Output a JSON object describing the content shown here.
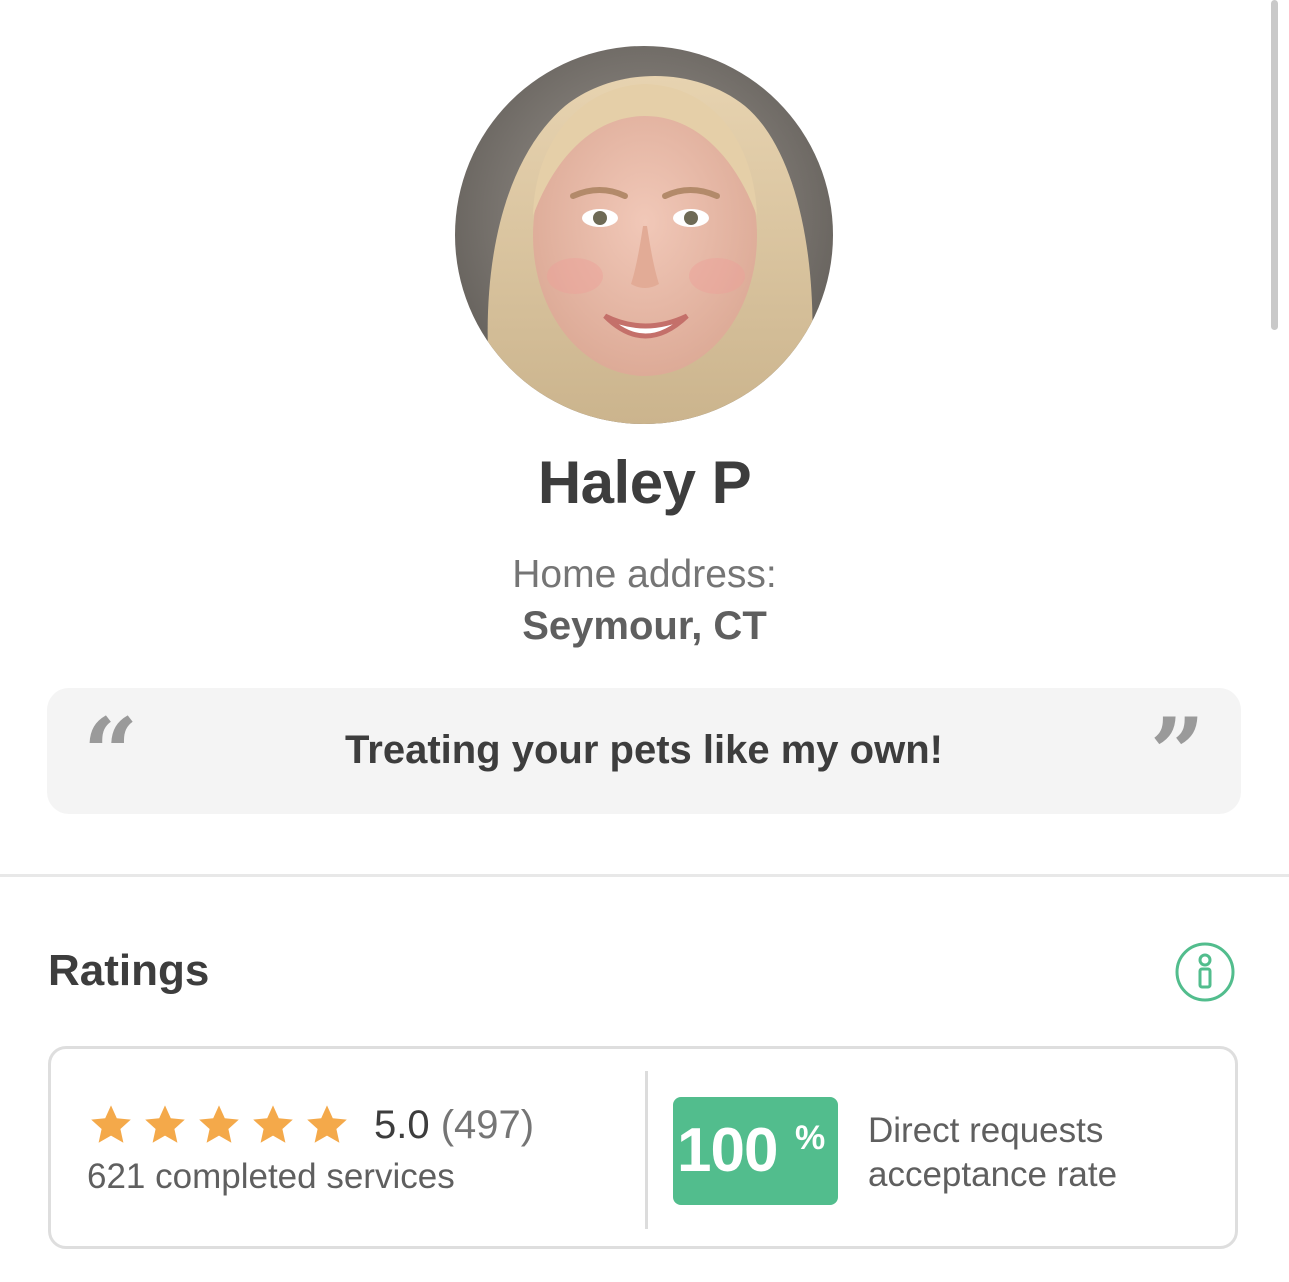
{
  "profile": {
    "name": "Haley P",
    "address_label": "Home address:",
    "address_value": "Seymour, CT",
    "tagline": "Treating your pets like my own!",
    "quote_open": "“",
    "quote_close": "”"
  },
  "ratings": {
    "title": "Ratings",
    "stars": 5,
    "score": "5.0",
    "review_count": "(497)",
    "completed": "621 completed services",
    "acceptance_value": "100",
    "acceptance_unit": "%",
    "acceptance_line1": "Direct requests",
    "acceptance_line2": "acceptance rate"
  },
  "colors": {
    "accent_green": "#52bd8d",
    "star": "#f4a94a",
    "text_dark": "#3d3d3d"
  },
  "icons": {
    "info": "info-icon",
    "star": "star-icon"
  }
}
